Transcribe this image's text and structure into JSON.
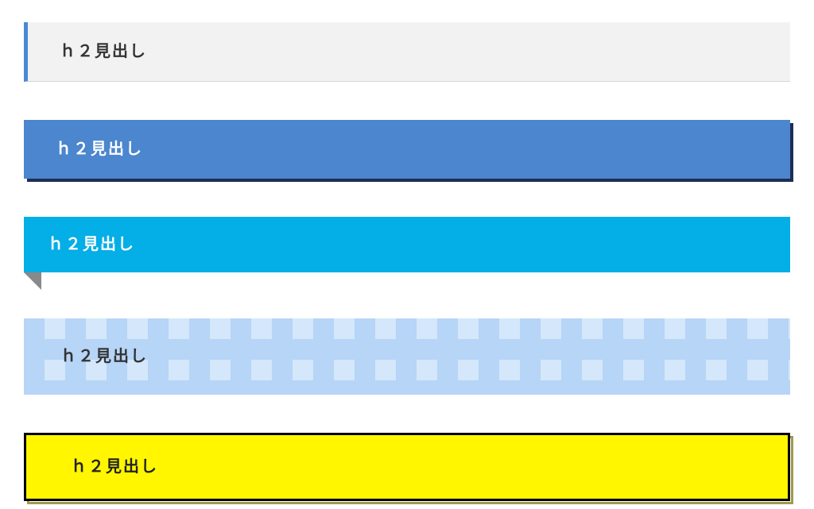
{
  "headings": {
    "style1": {
      "text": "ｈ２見出し"
    },
    "style2": {
      "text": "ｈ２見出し"
    },
    "style3": {
      "text": "ｈ２見出し"
    },
    "style4": {
      "text": "ｈ２見出し"
    },
    "style5": {
      "text": "ｈ２見出し"
    }
  },
  "colors": {
    "accent_blue": "#4a89d4",
    "solid_blue": "#4b86ce",
    "shadow_navy": "#1d2e54",
    "cyan": "#04aee6",
    "ribbon_fold": "#88898a",
    "check_base": "#d4e7fb",
    "check_stripe": "#b6d5f7",
    "yellow": "#fff600",
    "box_border": "#000000"
  }
}
